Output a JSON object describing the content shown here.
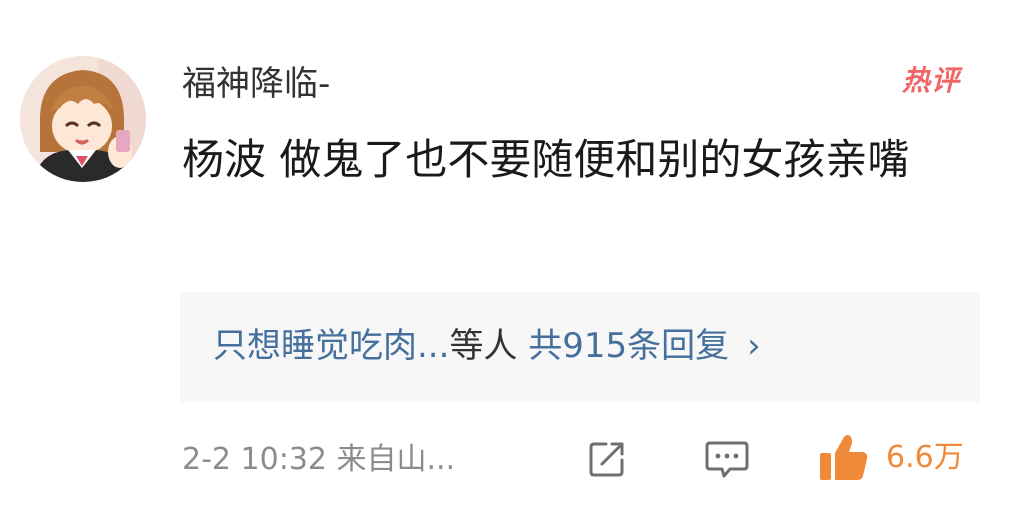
{
  "comment": {
    "username": "福神降临-",
    "badge": "热评",
    "text": "杨波 做鬼了也不要随便和别的女孩亲嘴",
    "replies": {
      "users": "只想睡觉吃肉...",
      "wait": "等人",
      "count": "共915条回复",
      "arrow": "›"
    },
    "meta": "2-2 10:32 来自山...",
    "likes": "6.6万"
  },
  "colors": {
    "link": "#456f9c",
    "like_accent": "#f08a3b",
    "hot_badge": "#f06567"
  },
  "icons": {
    "share": "share-icon",
    "comment": "comment-icon",
    "like": "thumbs-up-icon"
  }
}
